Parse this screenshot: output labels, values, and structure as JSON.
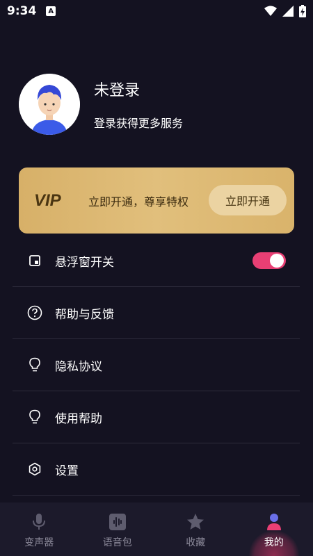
{
  "status_bar": {
    "time": "9:34",
    "notification_badge": "A"
  },
  "profile": {
    "title": "未登录",
    "subtitle": "登录获得更多服务"
  },
  "vip": {
    "logo": "VIP",
    "text": "立即开通，尊享特权",
    "button": "立即开通"
  },
  "menu": [
    {
      "label": "悬浮窗开关",
      "icon": "floating-window-icon",
      "toggle": true
    },
    {
      "label": "帮助与反馈",
      "icon": "help-icon"
    },
    {
      "label": "隐私协议",
      "icon": "lightbulb-icon"
    },
    {
      "label": "使用帮助",
      "icon": "lightbulb-icon"
    },
    {
      "label": "设置",
      "icon": "settings-icon"
    }
  ],
  "tabs": [
    {
      "label": "变声器",
      "icon": "microphone-icon",
      "active": false
    },
    {
      "label": "语音包",
      "icon": "voice-pack-icon",
      "active": false
    },
    {
      "label": "收藏",
      "icon": "star-icon",
      "active": false
    },
    {
      "label": "我的",
      "icon": "profile-icon",
      "active": true
    }
  ],
  "colors": {
    "background": "#141221",
    "accent": "#e83f74",
    "vip_gold": "#d9b36b"
  }
}
